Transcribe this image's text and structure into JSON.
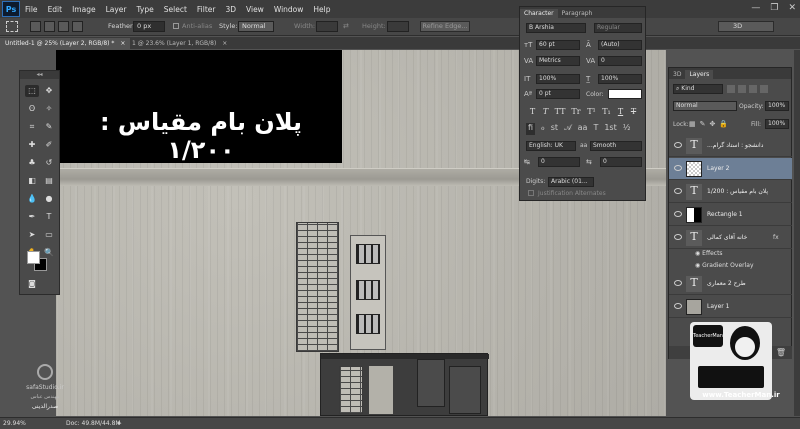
{
  "app": {
    "logo": "Ps"
  },
  "menu": [
    "File",
    "Edit",
    "Image",
    "Layer",
    "Type",
    "Select",
    "Filter",
    "3D",
    "View",
    "Window",
    "Help"
  ],
  "window_controls": [
    "—",
    "❐",
    "✕"
  ],
  "options_bar": {
    "feather_label": "Feather:",
    "feather_value": "0 px",
    "antialias_label": "Anti-alias",
    "style_label": "Style:",
    "style_value": "Normal",
    "width_label": "Width:",
    "height_label": "Height:",
    "refine_edge": "Refine Edge...",
    "workspace": "3D"
  },
  "doc_tabs": [
    {
      "label": "Untitled-1 @ 25% (Layer 2, RGB/8) *",
      "close": "×"
    },
    {
      "label": "1 @ 23.6% (Layer 1, RGB/8)",
      "close": "×"
    }
  ],
  "canvas": {
    "title_text": "پلان بام  مقیاس : ۱/۲۰۰"
  },
  "toolbar": {
    "header": "◂◂"
  },
  "character_panel": {
    "tabs": [
      "Character",
      "Paragraph"
    ],
    "font_family": "B Arshia",
    "font_style": "Regular",
    "font_size": "60 pt",
    "leading": "(Auto)",
    "kerning": "Metrics",
    "tracking": "0",
    "vscale": "100%",
    "hscale": "100%",
    "baseline": "0 pt",
    "color_label": "Color:",
    "type_buttons": [
      "T",
      "T",
      "TT",
      "Tr",
      "T¹",
      "T₁",
      "T",
      "T"
    ],
    "language": "English: UK",
    "aa_label": "aa",
    "antialias": "Smooth",
    "opt_a": "0",
    "opt_b": "0",
    "digits_label": "Digits:",
    "digits_value": "Arabic (01...",
    "justification": "Justification Alternates"
  },
  "layers_panel": {
    "tabs": [
      "3D",
      "Layers"
    ],
    "filter": "Kind",
    "blend": "Normal",
    "opacity_label": "Opacity:",
    "opacity": "100%",
    "lock_label": "Lock:",
    "fill_label": "Fill:",
    "fill": "100%",
    "layers": [
      {
        "name": "...دانشجو : استاد گرام",
        "type": "text"
      },
      {
        "name": "Layer 2",
        "type": "image",
        "selected": true
      },
      {
        "name": "پلان بام  مقیاس : 1/200",
        "type": "text"
      },
      {
        "name": "Rectangle 1",
        "type": "shape"
      },
      {
        "name": "خانه آقای کمالی",
        "type": "text"
      },
      {
        "name": "طرح 2 معماری",
        "type": "text"
      },
      {
        "name": "Layer 1",
        "type": "image"
      }
    ],
    "effects_label": "Effects",
    "gradient_overlay": "Gradient Overlay",
    "fx": "fx"
  },
  "status": {
    "zoom": "29.94%",
    "doc": "Doc: 49.8M/44.8M"
  },
  "watermarks": {
    "teacherman_url": "www.TeacherMan.ir",
    "safa_name": "safaStudio.ir",
    "safa_sub": "مهندس عباس",
    "safa_sub2": "صدرالدینی",
    "tm_text": "TeacherMan"
  }
}
